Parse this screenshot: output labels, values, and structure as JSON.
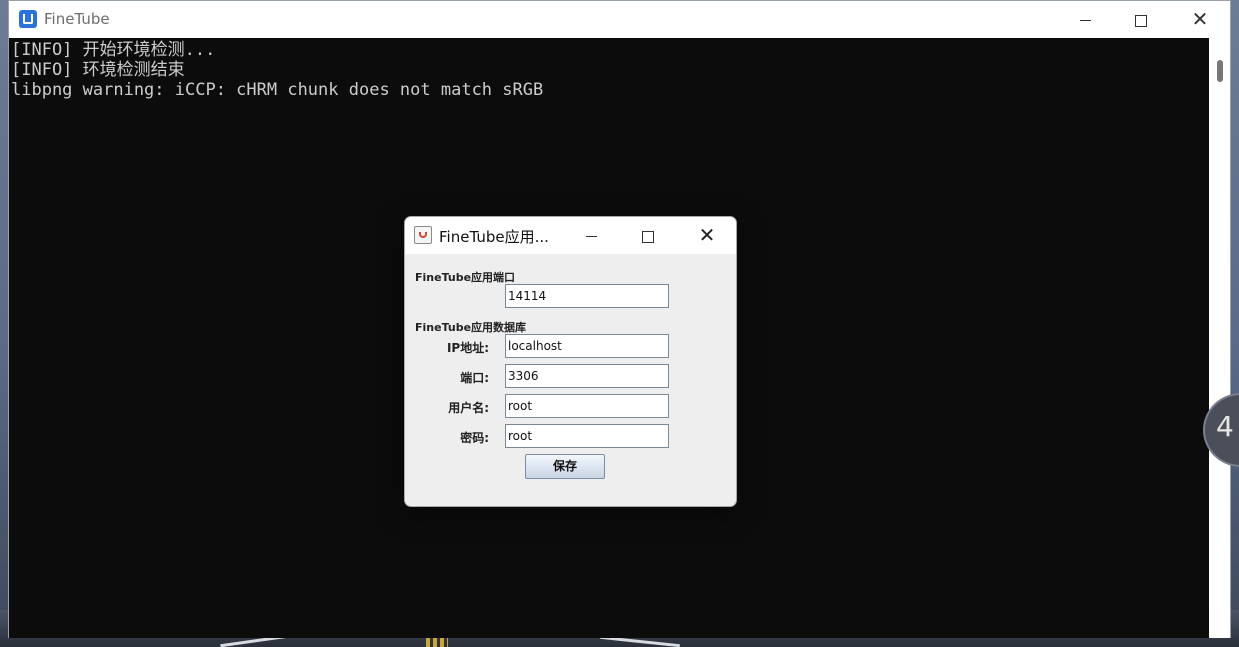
{
  "main_window": {
    "title": "FineTube",
    "console_lines": [
      "[INFO] 开始环境检测...",
      "[INFO] 环境检测结束",
      "libpng warning: iCCP: cHRM chunk does not match sRGB"
    ]
  },
  "dialog": {
    "title": "FineTube应用...",
    "section_app_port": "FineTube应用端口",
    "app_port_value": "14114",
    "section_db": "FineTube应用数据库",
    "ip_label": "IP地址:",
    "ip_value": "localhost",
    "db_port_label": "端口:",
    "db_port_value": "3306",
    "username_label": "用户名:",
    "username_value": "root",
    "password_label": "密码:",
    "password_value": "root",
    "save_label": "保存"
  },
  "side_widget": {
    "text": "4"
  },
  "colors": {
    "console_bg": "#0c0c0c",
    "console_text": "#cccccc",
    "dialog_bg": "#eeeeee",
    "app_icon": "#2a73d6"
  },
  "icons": [
    "finetube-app-icon",
    "java-icon",
    "minimize-icon",
    "maximize-icon",
    "close-icon"
  ]
}
